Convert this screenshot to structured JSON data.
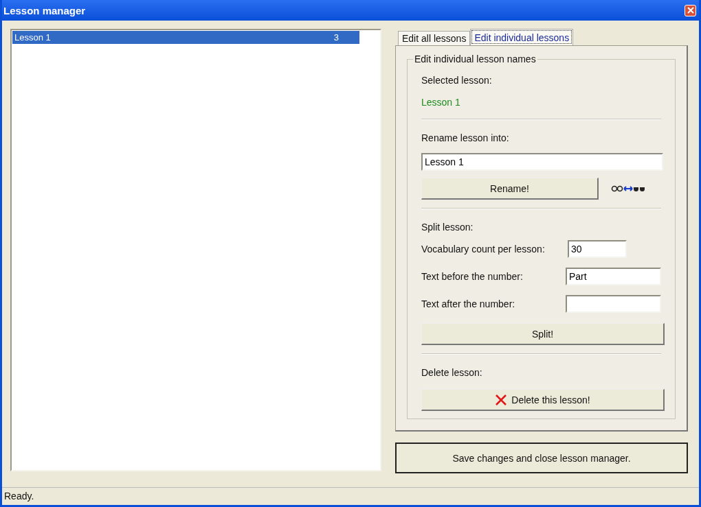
{
  "window": {
    "title": "Lesson manager"
  },
  "lessons": [
    {
      "name": "Lesson 1",
      "count": "3",
      "selected": true
    }
  ],
  "tabs": [
    {
      "label": "Edit all lessons",
      "selected": false
    },
    {
      "label": "Edit individual lessons",
      "selected": true
    }
  ],
  "group": {
    "title": "Edit individual lesson names",
    "selected_label": "Selected lesson:",
    "selected_value": "Lesson 1",
    "rename_label": "Rename lesson into:",
    "rename_value": "Lesson 1",
    "rename_button": "Rename!",
    "split_label": "Split lesson:",
    "split_fields": [
      {
        "label": "Vocabulary count per lesson:",
        "value": "30",
        "kind": "short"
      },
      {
        "label": "Text before the number:",
        "value": "Part",
        "kind": "long"
      },
      {
        "label": "Text after the number:",
        "kind": "long"
      }
    ],
    "split_button": "Split!",
    "delete_label": "Delete lesson:",
    "delete_button": "Delete this lesson!"
  },
  "save_button": "Save changes and close lesson manager.",
  "status_bar": "Ready."
}
